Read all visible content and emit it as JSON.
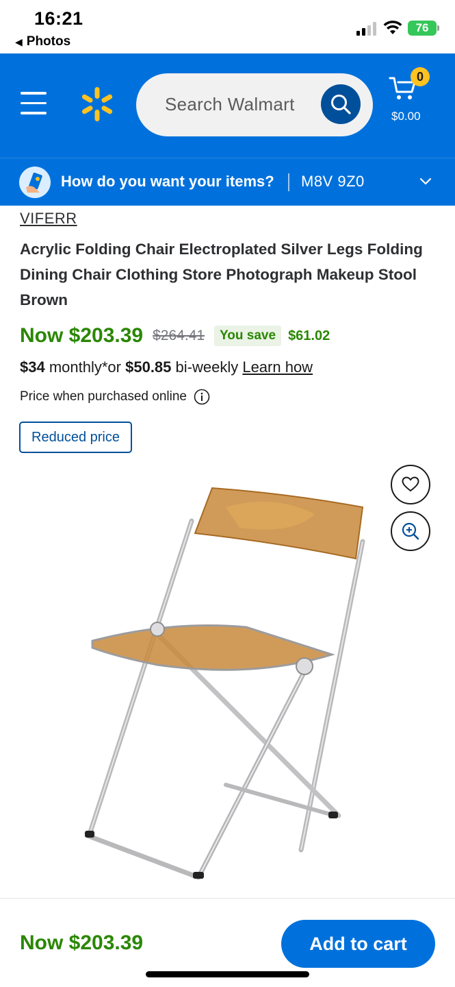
{
  "status_bar": {
    "time": "16:21",
    "back_label": "Photos",
    "battery": "76"
  },
  "header": {
    "search_placeholder": "Search Walmart",
    "cart_count": "0",
    "cart_total": "$0.00"
  },
  "fulfillment": {
    "question": "How do you want your items?",
    "separator": "|",
    "postal_code": "M8V 9Z0"
  },
  "product": {
    "brand": "VIFERR",
    "title": "Acrylic Folding Chair Electroplated Silver Legs Folding Dining Chair Clothing Store Photograph Makeup Stool Brown",
    "price_now": "Now $203.39",
    "price_was": "$264.41",
    "you_save_label": "You save",
    "you_save_amount": "$61.02",
    "finance": {
      "monthly_amount": "$34",
      "monthly_text": " monthly*or ",
      "biweekly_amount": "$50.85",
      "biweekly_text": " bi-weekly ",
      "learn_how": "Learn how"
    },
    "price_online_note": "Price when purchased online",
    "badge": "Reduced price",
    "image_alt": "Acrylic folding chair, amber seat, silver legs"
  },
  "bottom_bar": {
    "price": "Now $203.39",
    "add_to_cart": "Add to cart"
  },
  "colors": {
    "walmart_blue": "#0071dc",
    "dark_blue": "#004f9a",
    "spark_yellow": "#ffc220",
    "price_green": "#2a8703"
  },
  "icons": [
    "menu-icon",
    "spark-logo-icon",
    "search-icon",
    "cart-icon",
    "chevron-down-icon",
    "info-icon",
    "heart-icon",
    "zoom-in-icon"
  ]
}
